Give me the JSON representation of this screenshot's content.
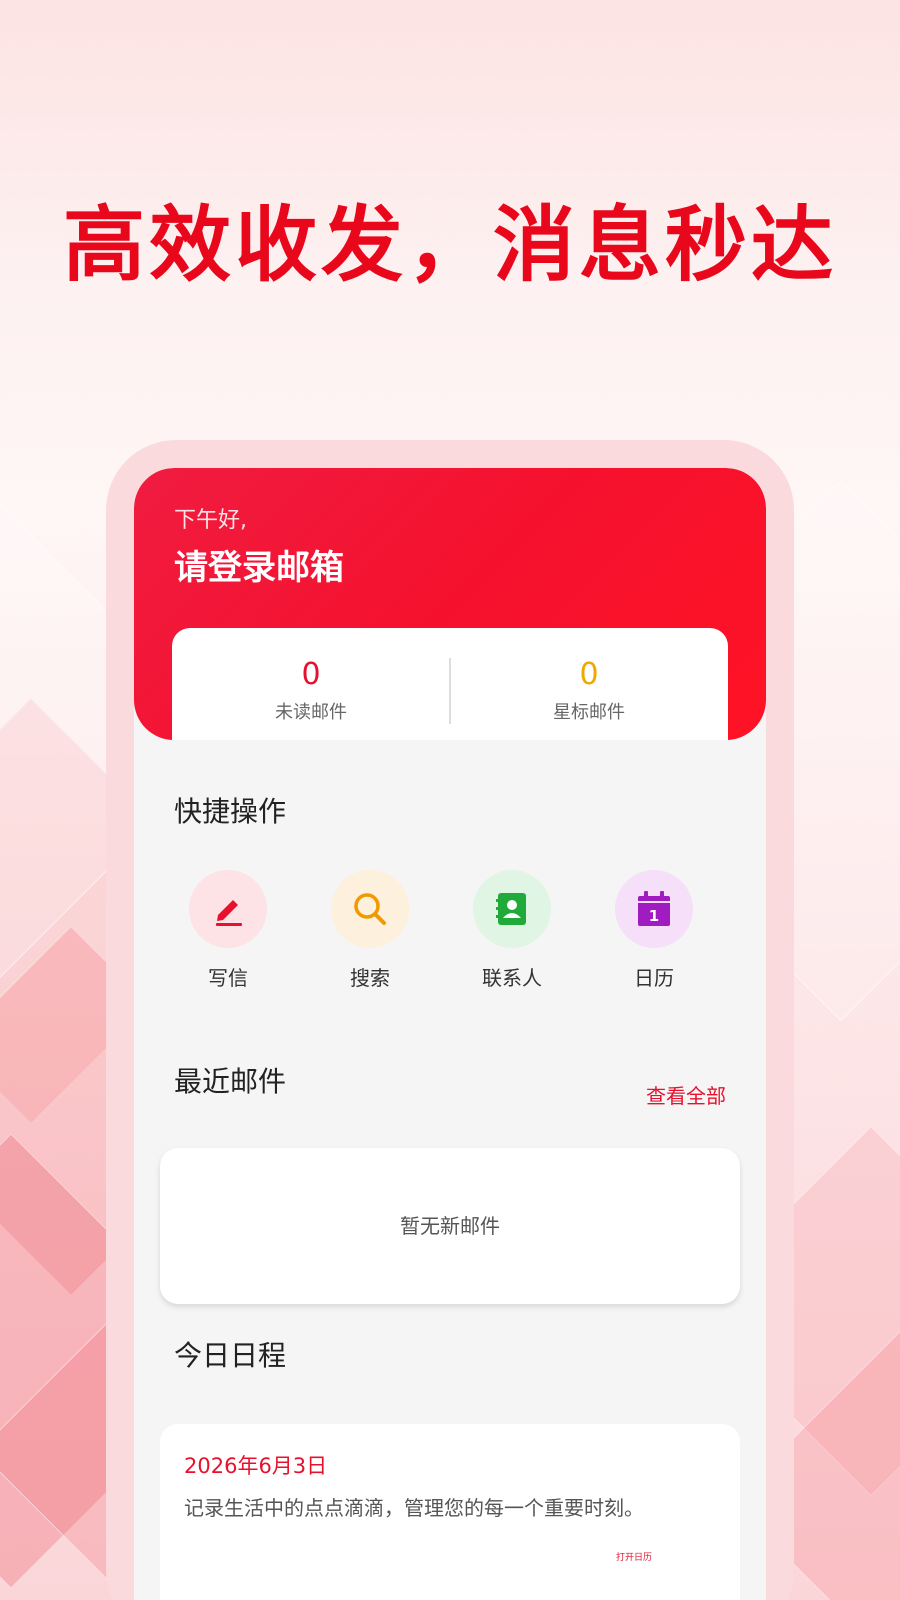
{
  "headline": "高效收发，消息秒达",
  "hero": {
    "greeting": "下午好,",
    "title": "请登录邮箱"
  },
  "stats": [
    {
      "value": "0",
      "label": "未读邮件",
      "color": "#e8112d"
    },
    {
      "value": "0",
      "label": "星标邮件",
      "color": "#f0a800"
    }
  ],
  "quick_actions": {
    "title": "快捷操作",
    "items": [
      {
        "label": "写信",
        "icon": "pen-icon",
        "color": "#e8112d",
        "bg": "#fde3e5"
      },
      {
        "label": "搜索",
        "icon": "search-icon",
        "color": "#f09a00",
        "bg": "#fdf0dc"
      },
      {
        "label": "联系人",
        "icon": "contacts-icon",
        "color": "#1faa3a",
        "bg": "#e0f5e4"
      },
      {
        "label": "日历",
        "icon": "calendar-icon",
        "color": "#a01cc0",
        "bg": "#f6dff8"
      }
    ]
  },
  "recent_mail": {
    "title": "最近邮件",
    "view_all": "查看全部",
    "empty": "暂无新邮件"
  },
  "schedule": {
    "title": "今日日程",
    "date": "2026年6月3日",
    "description": "记录生活中的点点滴滴，管理您的每一个重要时刻。",
    "open_calendar": "打开日历"
  }
}
